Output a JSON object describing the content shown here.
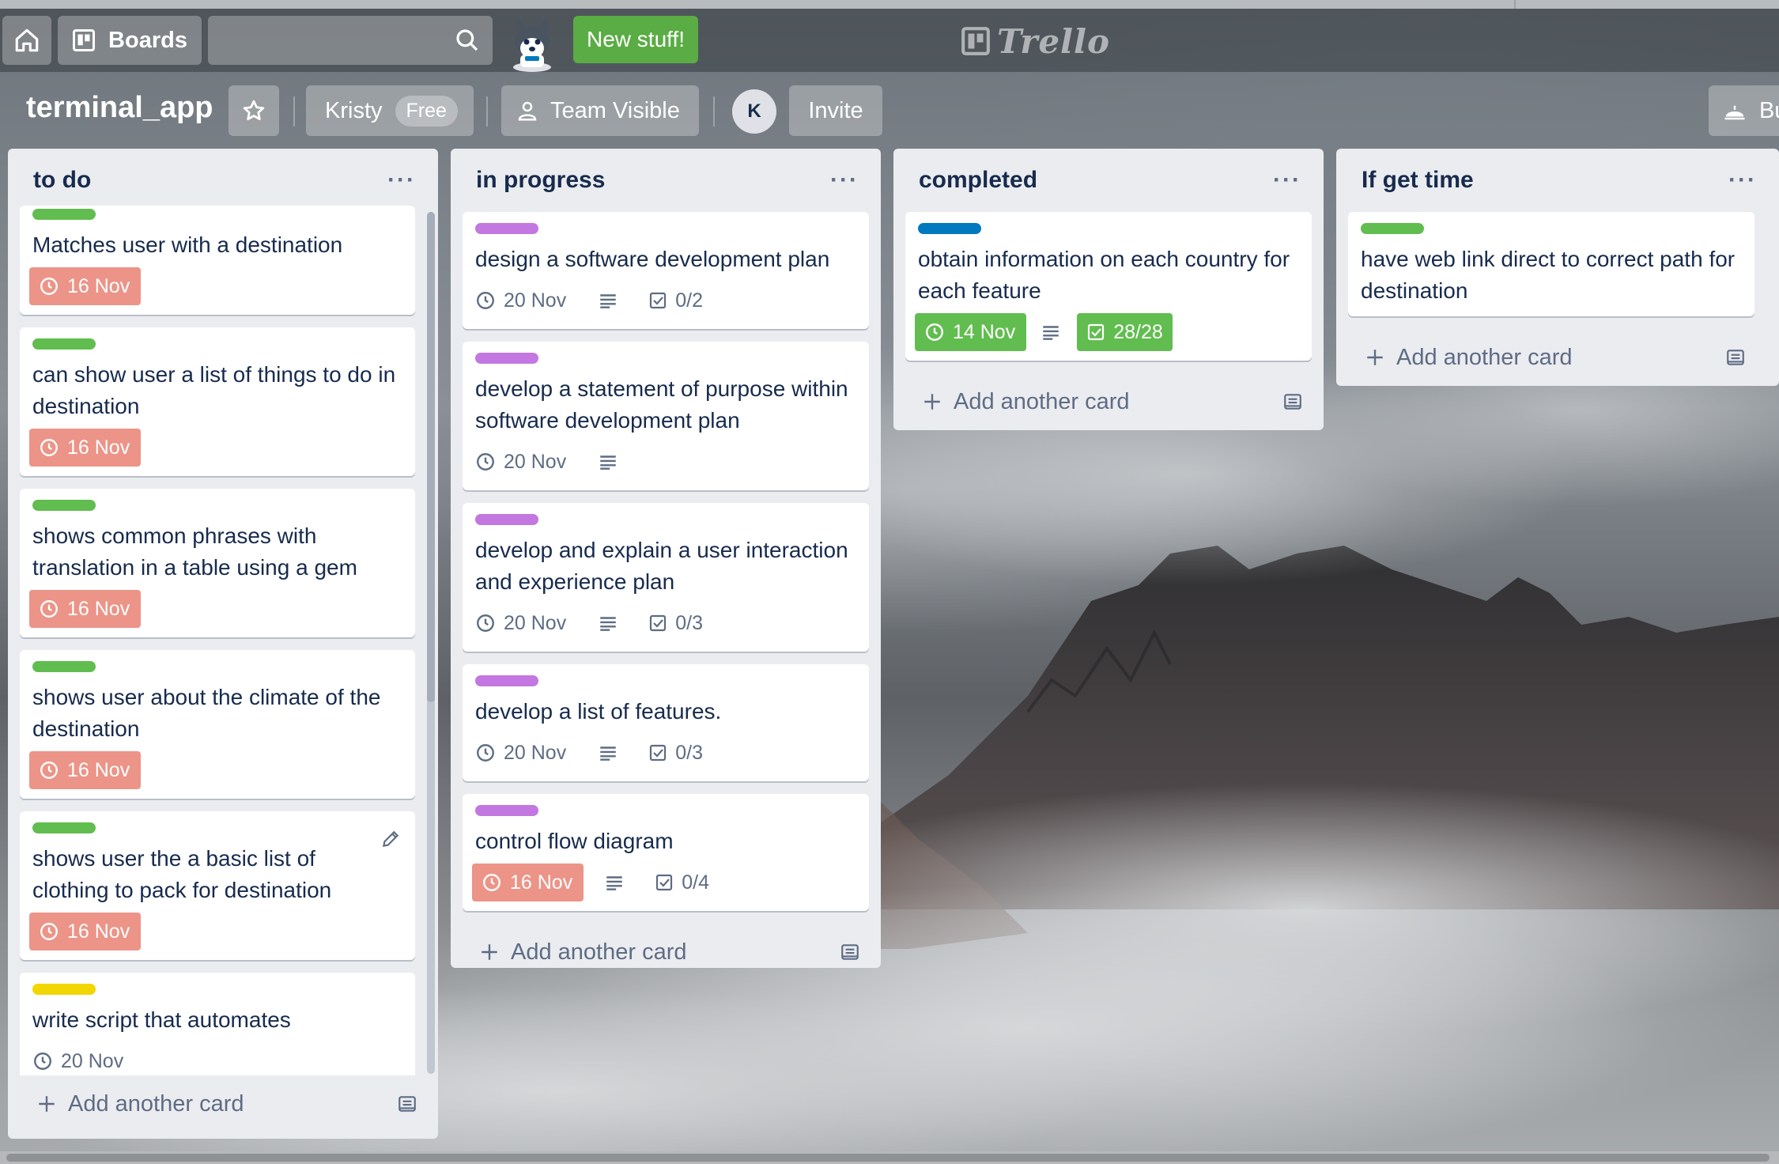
{
  "header": {
    "home_icon": "home-icon",
    "boards_label": "Boards",
    "search_icon": "search-icon",
    "new_stuff_label": "New stuff!",
    "logo_text": "Trello"
  },
  "board": {
    "title": "terminal_app",
    "workspace": "Kristy",
    "plan_badge": "Free",
    "visibility": "Team Visible",
    "member_initial": "K",
    "invite_label": "Invite",
    "butler_label": "Bu"
  },
  "colors": {
    "green_label": "#61bd4f",
    "purple_label": "#c377e0",
    "blue_label": "#0079bf",
    "yellow_label": "#f2d600",
    "overdue": "#ec9488",
    "complete": "#61bd4f",
    "new_stuff": "#5aac44"
  },
  "lists": [
    {
      "title": "to do",
      "menu": "···",
      "add_card": "Add another card",
      "cards": [
        {
          "label": "green",
          "title": "Matches user with a destination",
          "due": "16 Nov",
          "due_state": "overdue"
        },
        {
          "label": "green",
          "title": "can show user a list of things to do in destination",
          "due": "16 Nov",
          "due_state": "overdue"
        },
        {
          "label": "green",
          "title": "shows common phrases with translation in a table using a gem",
          "due": "16 Nov",
          "due_state": "overdue"
        },
        {
          "label": "green",
          "title": "shows user about the climate of the destination",
          "due": "16 Nov",
          "due_state": "overdue"
        },
        {
          "label": "green",
          "title": "shows user the a basic list of clothing to pack for destination",
          "due": "16 Nov",
          "due_state": "overdue"
        },
        {
          "label": "yellow",
          "title": "write script that automates",
          "due": "20 Nov",
          "due_state": "plain"
        }
      ]
    },
    {
      "title": "in progress",
      "menu": "···",
      "add_card": "Add another card",
      "cards": [
        {
          "label": "purple",
          "title": "design a software development plan",
          "due": "20 Nov",
          "due_state": "plain",
          "checklist": "0/2"
        },
        {
          "label": "purple",
          "title": "develop a statement of purpose within software development plan",
          "due": "20 Nov",
          "due_state": "plain"
        },
        {
          "label": "purple",
          "title": "develop and explain a user interaction and experience plan",
          "due": "20 Nov",
          "due_state": "plain",
          "checklist": "0/3"
        },
        {
          "label": "purple",
          "title": "develop a list of features.",
          "due": "20 Nov",
          "due_state": "plain",
          "checklist": "0/3"
        },
        {
          "label": "purple",
          "title": "control flow diagram",
          "due": "16 Nov",
          "due_state": "overdue",
          "checklist": "0/4"
        }
      ]
    },
    {
      "title": "completed",
      "menu": "···",
      "add_card": "Add another card",
      "cards": [
        {
          "label": "blue",
          "title": "obtain information on each country for each feature",
          "due": "14 Nov",
          "due_state": "complete",
          "checklist": "28/28"
        }
      ]
    },
    {
      "title": "If get time",
      "menu": "···",
      "add_card": "Add another card",
      "cards": [
        {
          "label": "green",
          "title": "have web link direct to correct path for destination"
        }
      ]
    }
  ]
}
